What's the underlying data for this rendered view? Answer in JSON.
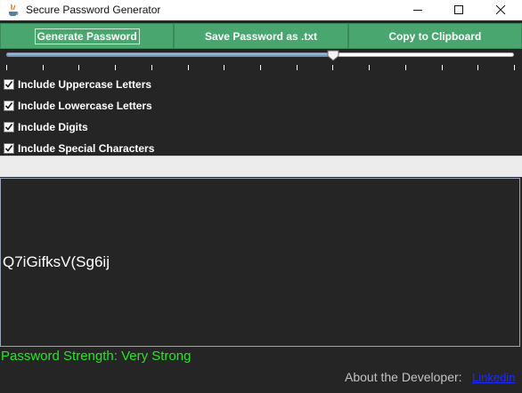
{
  "window": {
    "title": "Secure Password Generator"
  },
  "toolbar": {
    "generate_label": "Generate Password",
    "save_label": "Save Password as .txt",
    "copy_label": "Copy to Clipboard"
  },
  "slider": {
    "value_fraction": 0.644,
    "tick_count": 15
  },
  "options": [
    {
      "label": "Include Uppercase Letters",
      "checked": true
    },
    {
      "label": "Include Lowercase Letters",
      "checked": true
    },
    {
      "label": "Include Digits",
      "checked": true
    },
    {
      "label": "Include Special Characters",
      "checked": true
    }
  ],
  "output": {
    "password": "Q7iGifksV(Sg6ij"
  },
  "strength": {
    "text": "Password Strength: Very Strong",
    "color": "#29e329"
  },
  "footer": {
    "about_label": "About the Developer:",
    "link_label": "Linkedin"
  },
  "colors": {
    "button_green": "#4aa66f",
    "background": "#252526",
    "link": "#1d2bff"
  }
}
